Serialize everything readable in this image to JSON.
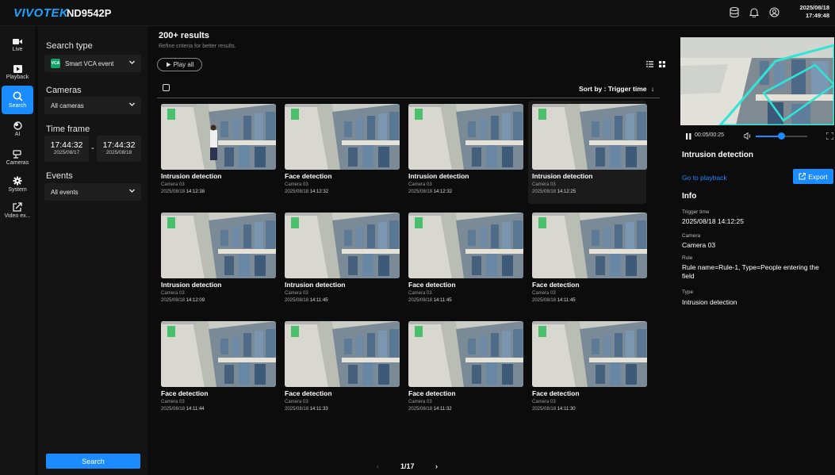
{
  "topbar": {
    "logo": "VIVOTEK",
    "model": "ND9542P",
    "date": "2025/08/18",
    "time": "17:49:48",
    "icons": [
      "storage-icon",
      "bell-icon",
      "user-icon"
    ]
  },
  "nav": [
    {
      "label": "Live",
      "icon": "video-icon"
    },
    {
      "label": "Playback",
      "icon": "playback-icon"
    },
    {
      "label": "Search",
      "icon": "search-icon",
      "active": true
    },
    {
      "label": "AI",
      "icon": "ai-icon"
    },
    {
      "label": "Cameras",
      "icon": "cameras-icon"
    },
    {
      "label": "System",
      "icon": "gear-icon"
    },
    {
      "label": "Video ex...",
      "icon": "export-icon"
    }
  ],
  "search": {
    "type_label": "Search type",
    "type_value": "Smart VCA event",
    "type_badge": "VCA",
    "cameras_label": "Cameras",
    "cameras_value": "All cameras",
    "timeframe_label": "Time frame",
    "start_time": "17:44:32",
    "start_date": "2025/08/17",
    "dash": "-",
    "end_time": "17:44:32",
    "end_date": "2025/08/18",
    "events_label": "Events",
    "events_value": "All events",
    "search_button": "Search"
  },
  "results": {
    "title": "200+ results",
    "subtitle": "Refine criteria for better results.",
    "play_all": "Play all",
    "sort_label": "Sort by : Trigger time",
    "sort_arrow": "↓",
    "items": [
      {
        "title": "Intrusion detection",
        "camera": "Camera 03",
        "date": "2025/08/18",
        "time": "14:12:38"
      },
      {
        "title": "Face detection",
        "camera": "Camera 03",
        "date": "2025/08/18",
        "time": "14:12:32"
      },
      {
        "title": "Intrusion detection",
        "camera": "Camera 03",
        "date": "2025/08/18",
        "time": "14:12:32"
      },
      {
        "title": "Intrusion detection",
        "camera": "Camera 03",
        "date": "2025/08/18",
        "time": "14:12:25",
        "selected": true
      },
      {
        "title": "Intrusion detection",
        "camera": "Camera 03",
        "date": "2025/08/18",
        "time": "14:12:09"
      },
      {
        "title": "Intrusion detection",
        "camera": "Camera 03",
        "date": "2025/08/18",
        "time": "14:11:45"
      },
      {
        "title": "Face detection",
        "camera": "Camera 03",
        "date": "2025/08/18",
        "time": "14:11:45"
      },
      {
        "title": "Face detection",
        "camera": "Camera 03",
        "date": "2025/08/18",
        "time": "14:11:45"
      },
      {
        "title": "Face detection",
        "camera": "Camera 03",
        "date": "2025/08/18",
        "time": "14:11:44"
      },
      {
        "title": "Face detection",
        "camera": "Camera 03",
        "date": "2025/08/18",
        "time": "14:11:33"
      },
      {
        "title": "Face detection",
        "camera": "Camera 03",
        "date": "2025/08/18",
        "time": "14:11:32"
      },
      {
        "title": "Face detection",
        "camera": "Camera 03",
        "date": "2025/08/18",
        "time": "14:11:30"
      }
    ],
    "page": "1/17",
    "prev": "‹",
    "next": "›"
  },
  "detail": {
    "time_display": "00:05/00:25",
    "volume_level": 0.5,
    "title": "Intrusion detection",
    "goto_playback": "Go to playback",
    "export": "Export",
    "info_heading": "Info",
    "trigger_time_label": "Trigger time",
    "trigger_time_value": "2025/08/18 14:12:25",
    "camera_label": "Camera",
    "camera_value": "Camera 03",
    "rule_label": "Rule",
    "rule_value": "Rule name=Rule-1, Type=People entering the field",
    "type_label": "Type",
    "type_value": "Intrusion detection"
  },
  "colors": {
    "accent": "#1a8cff",
    "background": "#0c0c0c",
    "panel": "#141414",
    "zone": "#2ee6d6"
  }
}
